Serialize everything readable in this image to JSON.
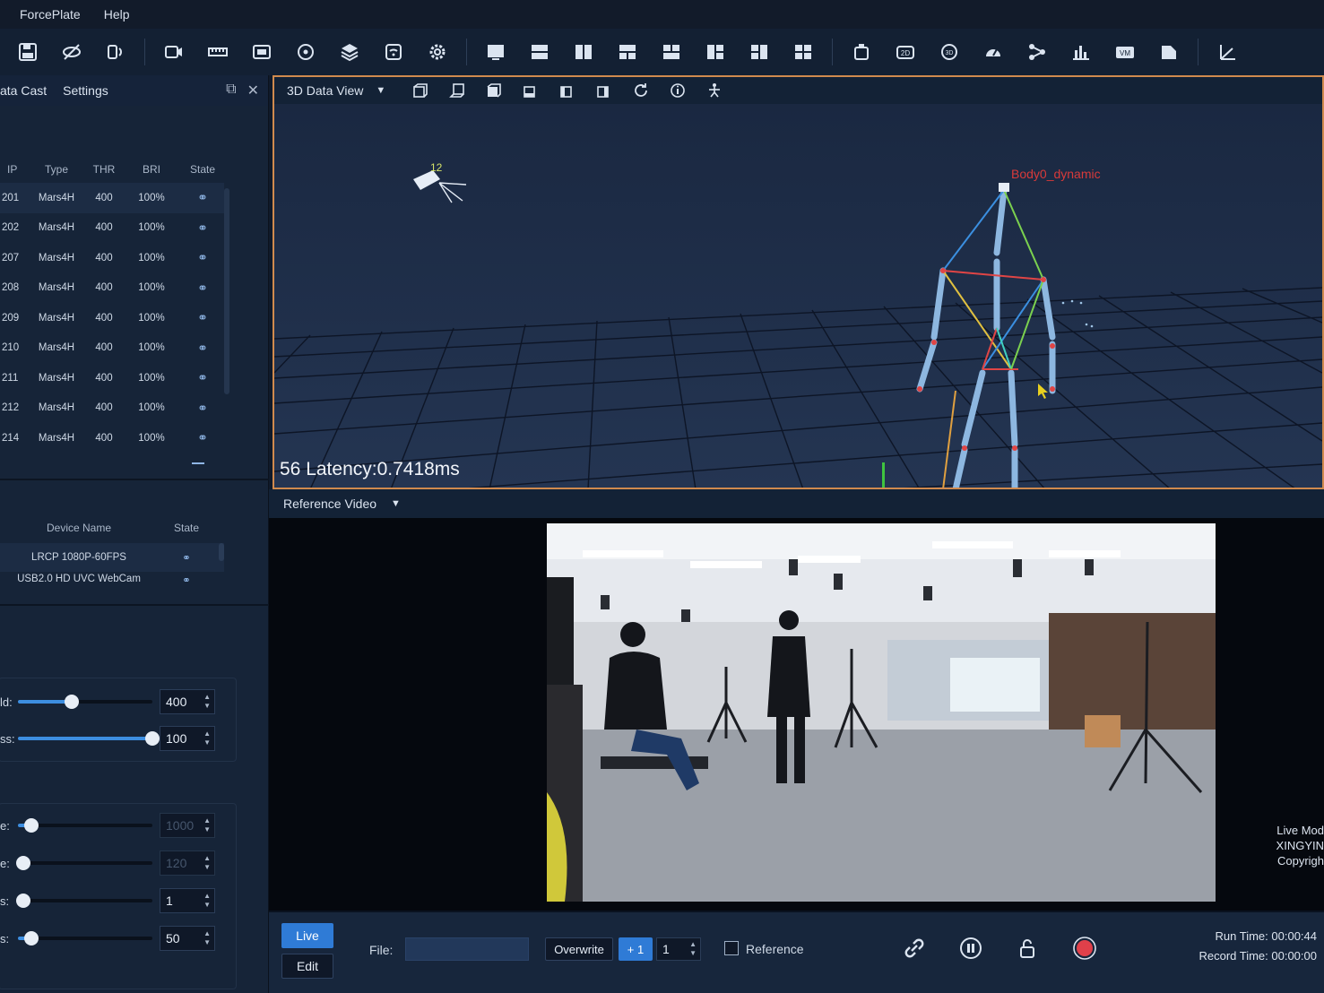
{
  "menu": [
    "ForcePlate",
    "Help"
  ],
  "toolbar_icons": [
    "save-icon",
    "hide-icon",
    "device-icon",
    "camera-icon",
    "ruler-icon",
    "calibrate-icon",
    "refresh-icon",
    "layers-icon",
    "wifi-icon",
    "gear-icon",
    "layout-single-icon",
    "layout-split-h-icon",
    "layout-split-v-icon",
    "layout-grid-a-icon",
    "layout-grid-b-icon",
    "layout-grid-c-icon",
    "layout-grid-d-icon",
    "layout-quad-icon",
    "view-3d-icon",
    "view-2d-icon",
    "view-sphere-icon",
    "gauge-icon",
    "skeleton-icon",
    "bar-chart-icon",
    "vm-icon",
    "document-icon",
    "axis-icon"
  ],
  "left_panel": {
    "tabs": [
      "ata Cast",
      "Settings"
    ],
    "camera_table": {
      "columns": [
        "IP",
        "Type",
        "THR",
        "BRI",
        "State"
      ],
      "rows": [
        {
          "ip": "201",
          "type": "Mars4H",
          "thr": "400",
          "bri": "100%"
        },
        {
          "ip": "202",
          "type": "Mars4H",
          "thr": "400",
          "bri": "100%"
        },
        {
          "ip": "207",
          "type": "Mars4H",
          "thr": "400",
          "bri": "100%"
        },
        {
          "ip": "208",
          "type": "Mars4H",
          "thr": "400",
          "bri": "100%"
        },
        {
          "ip": "209",
          "type": "Mars4H",
          "thr": "400",
          "bri": "100%"
        },
        {
          "ip": "210",
          "type": "Mars4H",
          "thr": "400",
          "bri": "100%"
        },
        {
          "ip": "211",
          "type": "Mars4H",
          "thr": "400",
          "bri": "100%"
        },
        {
          "ip": "212",
          "type": "Mars4H",
          "thr": "400",
          "bri": "100%"
        },
        {
          "ip": "214",
          "type": "Mars4H",
          "thr": "400",
          "bri": "100%"
        }
      ]
    },
    "device_table": {
      "columns": [
        "Device Name",
        "State"
      ],
      "rows": [
        {
          "name": "LRCP 1080P-60FPS"
        },
        {
          "name": "USB2.0 HD UVC WebCam"
        }
      ]
    },
    "sliders": [
      {
        "label": "ld:",
        "value": "400",
        "level": 0.4,
        "disabled": false
      },
      {
        "label": "ss:",
        "value": "100",
        "level": 1.0,
        "disabled": false
      },
      {
        "label": "e:",
        "value": "1000",
        "level": 0.1,
        "disabled": true
      },
      {
        "label": "e:",
        "value": "120",
        "level": 0.04,
        "disabled": true
      },
      {
        "label": "s:",
        "value": "1",
        "level": 0.0,
        "disabled": false
      },
      {
        "label": "s:",
        "value": "50",
        "level": 0.1,
        "disabled": false
      }
    ]
  },
  "view3d": {
    "title": "3D Data View",
    "camera_id": "12",
    "body_label": "Body0_dynamic",
    "latency": "56 Latency:0.7418ms"
  },
  "reference": {
    "title": "Reference Video",
    "live_info": [
      "Live Mod",
      "XINGYIN",
      "Copyrigh"
    ]
  },
  "bottom": {
    "live_label": "Live",
    "edit_label": "Edit",
    "file_label": "File:",
    "file_value": "",
    "overwrite_label": "Overwrite",
    "plus_label": "+ 1",
    "counter_value": "1",
    "reference_label": "Reference",
    "run_time": "Run Time:  00:00:44",
    "record_time": "Record Time:  00:00:00"
  },
  "colors": {
    "accent": "#2f7bd6",
    "view_border": "#d08a4e",
    "record": "#e0404a",
    "body_label": "#d83a3a"
  }
}
